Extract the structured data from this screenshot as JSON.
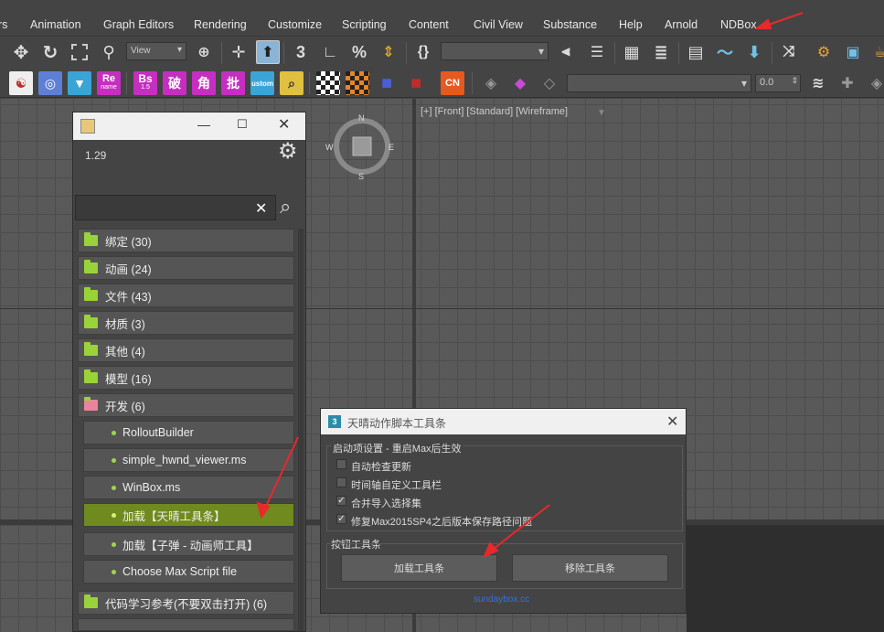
{
  "menubar": {
    "items": [
      "rs",
      "Animation",
      "Graph Editors",
      "Rendering",
      "Customize",
      "Scripting",
      "Content",
      "Civil View",
      "Substance",
      "Help",
      "Arnold",
      "NDBox"
    ]
  },
  "toolbar": {
    "view_dropdown": "View",
    "spinner_value": "0.0",
    "icons": {
      "bs_label": "Bs",
      "bs_sub": "1.5",
      "re_label": "Re",
      "re_sub": "name",
      "po": "破",
      "jiao": "角",
      "pi": "批",
      "cn": "CN",
      "ustom": "ustom",
      "num3": "3"
    }
  },
  "viewport": {
    "label": "[+] [Front] [Standard] [Wireframe]",
    "compass": {
      "n": "N",
      "s": "S",
      "w": "W",
      "e": "E"
    }
  },
  "ndbox": {
    "version": "1.29",
    "search_placeholder": "",
    "categories": [
      "绑定 (30)",
      "动画 (24)",
      "文件 (43)",
      "材质 (3)",
      "其他 (4)",
      "模型 (16)",
      "开发 (6)"
    ],
    "dev_items": [
      "RolloutBuilder",
      "simple_hwnd_viewer.ms",
      "WinBox.ms",
      "加载【天晴工具条】",
      "加载【子弹 - 动画师工具】",
      "Choose Max Script file"
    ],
    "bottom_category": "代码学习参考(不要双击打开) (6)"
  },
  "dialog": {
    "title": "天晴动作脚本工具条",
    "startup_group": "启动项设置 - 重启Max后生效",
    "options": [
      {
        "label": "自动检查更新",
        "checked": false
      },
      {
        "label": "时间轴自定义工具栏",
        "checked": false
      },
      {
        "label": "合并导入选择集",
        "checked": true
      },
      {
        "label": "修复Max2015SP4之后版本保存路径问题",
        "checked": true
      }
    ],
    "button_group": "按钮工具条",
    "load_button": "加载工具条",
    "remove_button": "移除工具条",
    "link": "sundaybox.cc"
  },
  "colors": {
    "accent_green": "#9ad23a",
    "selected_item": "#6f8a1e",
    "arrow_red": "#e8282b",
    "link_blue": "#3b6ee0"
  }
}
